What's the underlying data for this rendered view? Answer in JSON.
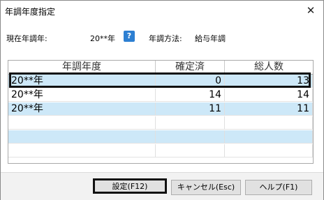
{
  "window": {
    "title": "年調年度指定",
    "close_glyph": "✕"
  },
  "info": {
    "current_year_label": "現在年調年:",
    "current_year_value": "20**年",
    "help_glyph": "?",
    "method_label": "年調方法:",
    "method_value": "給与年調"
  },
  "table": {
    "columns": [
      "年調年度",
      "確定済",
      "総人数"
    ],
    "rows": [
      {
        "year": "20**年",
        "confirmed": "0",
        "total": "13"
      },
      {
        "year": "20**年",
        "confirmed": "14",
        "total": "14"
      },
      {
        "year": "20**年",
        "confirmed": "11",
        "total": "11"
      },
      {
        "year": "",
        "confirmed": "",
        "total": ""
      },
      {
        "year": "",
        "confirmed": "",
        "total": ""
      },
      {
        "year": "",
        "confirmed": "",
        "total": ""
      }
    ],
    "selected_row": 0
  },
  "buttons": {
    "settings": "設定(F12)",
    "cancel": "キャンセル(Esc)",
    "help": "ヘルプ(F1)"
  },
  "colors": {
    "row_highlight": "#cde8f8",
    "help_icon": "#2d7fd2"
  }
}
